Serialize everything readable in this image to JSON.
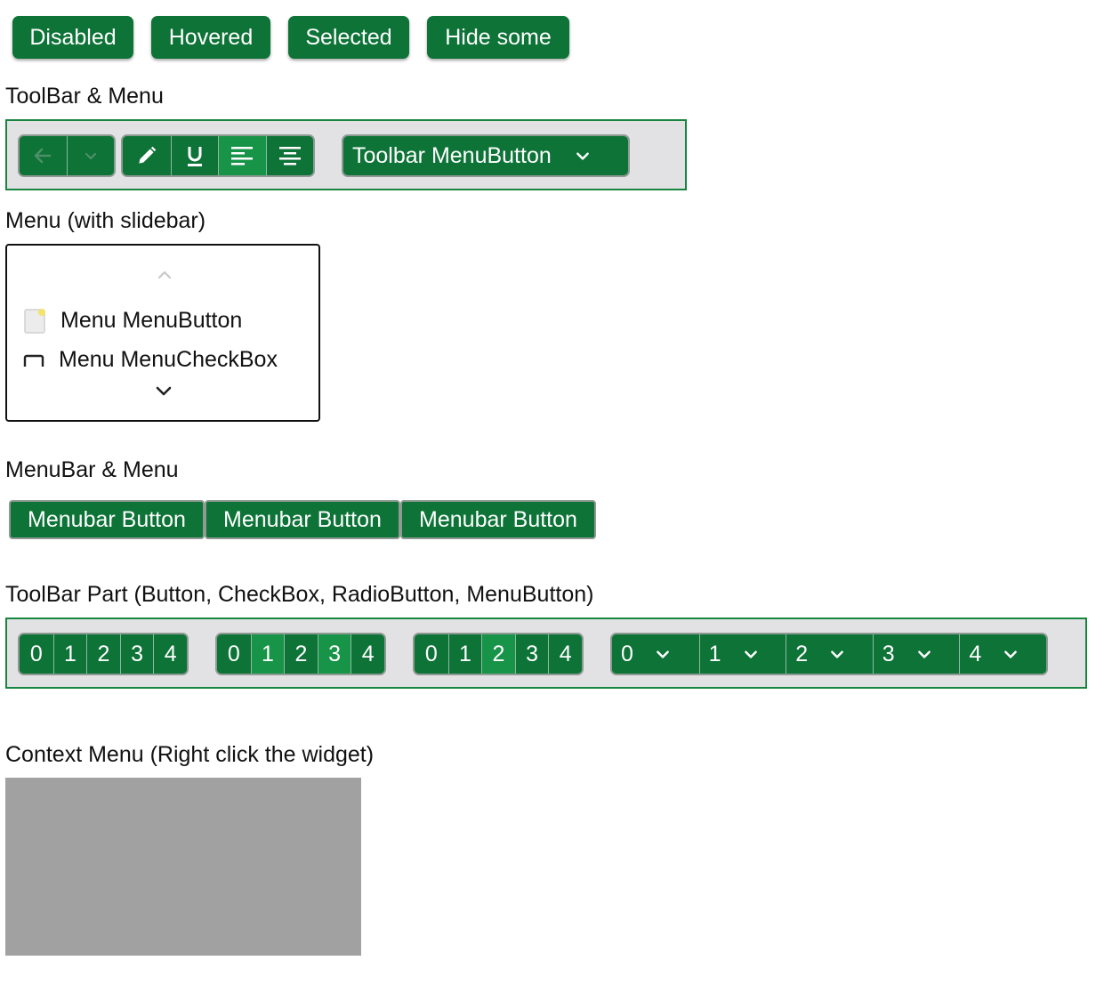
{
  "top_buttons": {
    "disabled": "Disabled",
    "hovered": "Hovered",
    "selected": "Selected",
    "hide_some": "Hide some"
  },
  "toolbar_section": {
    "title": "ToolBar & Menu",
    "menu_button_label": "Toolbar MenuButton",
    "icons": [
      "arrow-left-icon",
      "chevron-down-icon",
      "pencil-icon",
      "underline-icon",
      "align-left-icon",
      "align-center-icon"
    ]
  },
  "menu_section": {
    "title": "Menu (with slidebar)",
    "items": [
      {
        "label": "Menu MenuButton",
        "icon": "document-icon"
      },
      {
        "label": "Menu MenuCheckBox",
        "icon": "checkbox-icon"
      }
    ]
  },
  "menubar_section": {
    "title": "MenuBar & Menu",
    "buttons": [
      "Menubar Button",
      "Menubar Button",
      "Menubar Button"
    ]
  },
  "toolbar_part_section": {
    "title": "ToolBar Part (Button, CheckBox, RadioButton, MenuButton)",
    "button_group": [
      "0",
      "1",
      "2",
      "3",
      "4"
    ],
    "checkbox_group": [
      "0",
      "1",
      "2",
      "3",
      "4"
    ],
    "radio_group": [
      "0",
      "1",
      "2",
      "3",
      "4"
    ],
    "menubutton_group": [
      "0",
      "1",
      "2",
      "3",
      "4"
    ],
    "checkbox_selected": [
      "1",
      "3"
    ],
    "radio_selected": "2"
  },
  "context_section": {
    "title": "Context Menu (Right click the widget)"
  },
  "colors": {
    "button_green": "#0d7337",
    "selected_green": "#179447",
    "toolbar_bg": "#e2e2e4",
    "toolbar_border": "#17843f",
    "context_widget": "#a1a1a1"
  }
}
